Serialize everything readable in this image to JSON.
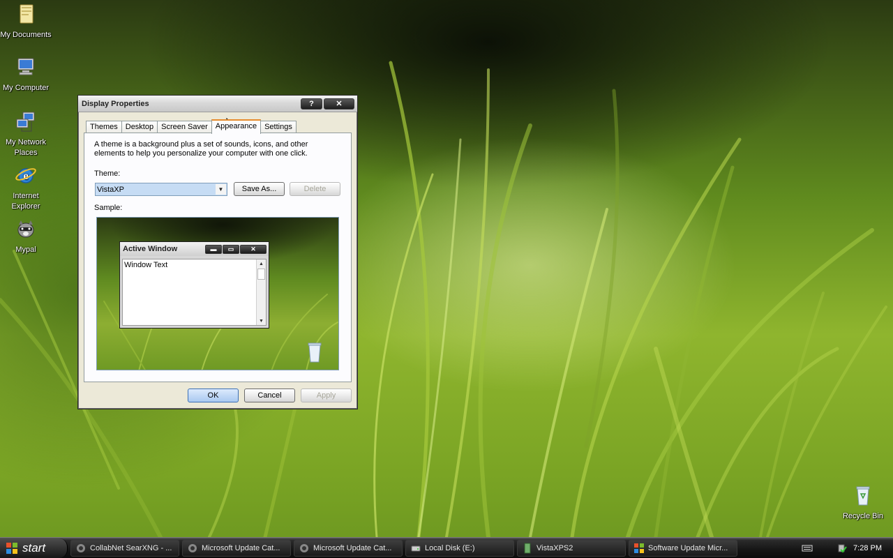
{
  "desktop": {
    "icons": [
      {
        "label": "My Documents"
      },
      {
        "label": "My Computer"
      },
      {
        "label": "My Network Places"
      },
      {
        "label": "Internet Explorer"
      },
      {
        "label": "Mypal"
      },
      {
        "label": "Recycle Bin"
      }
    ]
  },
  "dialog": {
    "title": "Display Properties",
    "help_btn": "?",
    "close_btn": "✕",
    "tabs": [
      "Themes",
      "Desktop",
      "Screen Saver",
      "Appearance",
      "Settings"
    ],
    "active_tab": "Appearance",
    "description": "A theme is a background plus a set of sounds, icons, and other elements to help you personalize your computer with one click.",
    "theme_label": "Theme:",
    "theme_value": "VistaXP",
    "save_as": "Save As...",
    "delete": "Delete",
    "sample_label": "Sample:",
    "sample_window_title": "Active Window",
    "sample_window_text": "Window Text",
    "ok": "OK",
    "cancel": "Cancel",
    "apply": "Apply"
  },
  "taskbar": {
    "start": "start",
    "tasks": [
      {
        "label": "CollabNet SearXNG - ..."
      },
      {
        "label": "Microsoft Update Cat..."
      },
      {
        "label": "Microsoft Update Cat..."
      },
      {
        "label": "Local Disk (E:)"
      },
      {
        "label": "VistaXPS2"
      },
      {
        "label": "Software Update Micr..."
      }
    ],
    "clock": "7:28 PM"
  }
}
